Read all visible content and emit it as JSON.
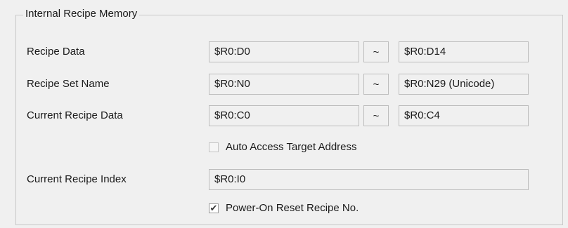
{
  "group": {
    "title": "Internal Recipe Memory"
  },
  "rows": {
    "recipe_data": {
      "label": "Recipe Data",
      "start": "$R0:D0",
      "separator": "~",
      "end": "$R0:D14"
    },
    "recipe_set_name": {
      "label": "Recipe Set Name",
      "start": "$R0:N0",
      "separator": "~",
      "end": "$R0:N29 (Unicode)"
    },
    "current_recipe_data": {
      "label": "Current Recipe Data",
      "start": "$R0:C0",
      "separator": "~",
      "end": "$R0:C4"
    },
    "auto_access": {
      "label": "Auto Access Target Address",
      "checked": false
    },
    "current_recipe_index": {
      "label": "Current Recipe Index",
      "value": "$R0:I0"
    },
    "power_on_reset": {
      "label": "Power-On Reset Recipe No.",
      "checked": true,
      "check_glyph": "✔"
    }
  }
}
